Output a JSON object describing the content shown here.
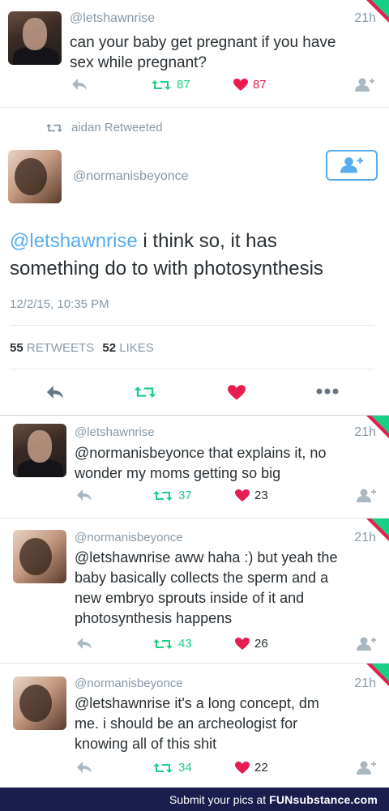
{
  "tweets": [
    {
      "handle": "@letshawnrise",
      "time": "21h",
      "line1": "can your baby get pregnant if you have",
      "line2": "sex while pregnant?",
      "retweets": "87",
      "likes": "87"
    },
    {
      "handle": "@letshawnrise",
      "time": "21h",
      "mention": "@normanisbeyonce",
      "line1": " that explains it, no",
      "line2": "wonder my moms getting so big",
      "retweets": "37",
      "likes": "23"
    },
    {
      "handle": "@normanisbeyonce",
      "time": "21h",
      "mention": "@letshawnrise",
      "line1": " aww haha :) but yeah the",
      "line2": "baby basically collects the sperm and a",
      "line3": "new embryo sprouts inside of it and",
      "line4": "photosynthesis happens",
      "retweets": "43",
      "likes": "26"
    },
    {
      "handle": "@normanisbeyonce",
      "time": "21h",
      "mention": "@letshawnrise",
      "line1": " it's a long concept, dm",
      "line2": "me. i should be an archeologist for",
      "line3": "knowing all of this shit",
      "retweets": "34",
      "likes": "22"
    }
  ],
  "retweet_header": "aidan Retweeted",
  "focused": {
    "handle": "@normanisbeyonce",
    "mention": "@letshawnrise",
    "line1": " i think so, it has",
    "line2": "something do to with photosynthesis",
    "timestamp": "12/2/15, 10:35 PM",
    "retweet_count": "55",
    "retweet_label": "RETWEETS",
    "like_count": "52",
    "like_label": "LIKES"
  },
  "footer": {
    "text": "Submit your pics at",
    "brand": "FUNsubstance.com"
  },
  "colors": {
    "accent": "#55acee",
    "retweet": "#19cf86",
    "like": "#e81c4f",
    "muted": "#8899a6",
    "footer_bg": "#1a1d4d"
  },
  "icons": [
    "reply-icon",
    "retweet-icon",
    "heart-icon",
    "follow-icon",
    "more-icon"
  ]
}
